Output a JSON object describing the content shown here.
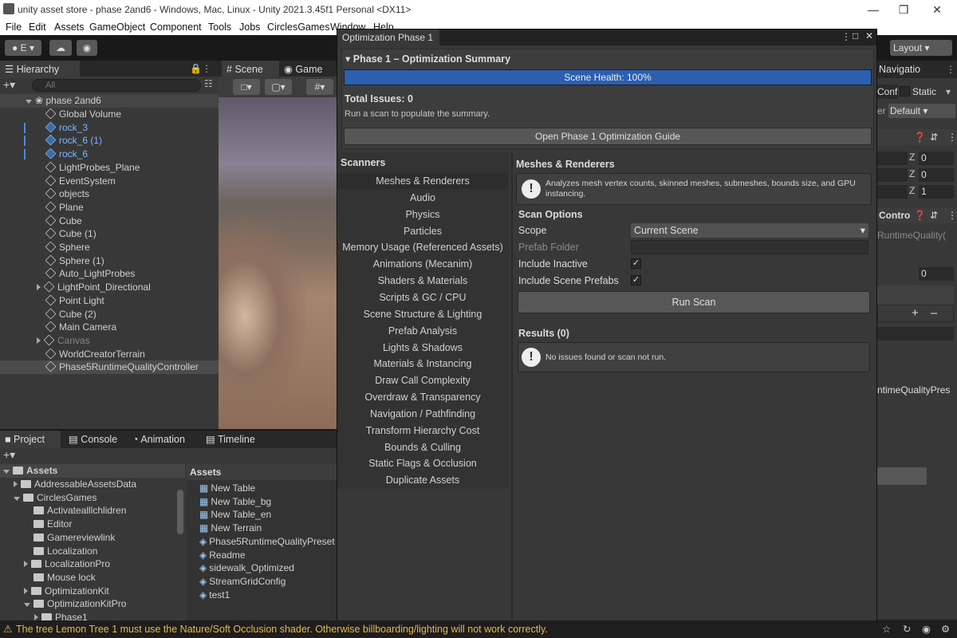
{
  "window": {
    "title": "unity asset store - phase 2and6 - Windows, Mac, Linux - Unity 2021.3.45f1 Personal <DX11>"
  },
  "menu": [
    "File",
    "Edit",
    "Assets",
    "GameObject",
    "Component",
    "Tools",
    "Jobs",
    "CirclesGames",
    "Window",
    "Help"
  ],
  "toolbar": {
    "account_label": "E",
    "layout_label": "Layout"
  },
  "hierarchy": {
    "tab": "Hierarchy",
    "search_placeholder": "All",
    "scene": "phase 2and6",
    "items": [
      "Global Volume",
      "rock_3",
      "rock_6 (1)",
      "rock_6",
      "LightProbes_Plane",
      "EventSystem",
      "objects",
      "Plane",
      "Cube",
      "Cube (1)",
      "Sphere",
      "Sphere (1)",
      "Auto_LightProbes",
      "LightPoint_Directional",
      "Point Light",
      "Cube (2)",
      "Main Camera",
      "Canvas",
      "WorldCreatorTerrain",
      "Phase5RuntimeQualityController"
    ]
  },
  "scene_tabs": {
    "scene": "Scene",
    "game": "Game"
  },
  "bottom_tabs": [
    "Project",
    "Console",
    "Animation",
    "Timeline"
  ],
  "project": {
    "root": "Assets",
    "tree": [
      "AddressableAssetsData",
      "CirclesGames",
      "Activatealllchlidren",
      "Editor",
      "Gamereviewlink",
      "Localization",
      "LocalizationPro",
      "Mouse lock",
      "OptimizationKit",
      "OptimizationKitPro",
      "Phase1"
    ],
    "assets_header": "Assets",
    "assets": [
      "New Table",
      "New Table_bg",
      "New Table_en",
      "New Terrain",
      "Phase5RuntimeQualityPreset",
      "Readme",
      "sidewalk_Optimized",
      "StreamGridConfig",
      "test1"
    ]
  },
  "opt": {
    "tab": "Optimization Phase 1",
    "summary_title": "Phase 1 – Optimization Summary",
    "health": "Scene Health: 100%",
    "health_value": 100,
    "total_issues": "Total Issues: 0",
    "hint": "Run a scan to populate the summary.",
    "guide_button": "Open Phase 1 Optimization Guide",
    "scanners_title": "Scanners",
    "scanners": [
      "Meshes & Renderers",
      "Audio",
      "Physics",
      "Particles",
      "Memory Usage (Referenced Assets)",
      "Animations (Mecanim)",
      "Shaders & Materials",
      "Scripts & GC / CPU",
      "Scene Structure & Lighting",
      "Prefab Analysis",
      "Lights & Shadows",
      "Materials & Instancing",
      "Draw Call Complexity",
      "Overdraw & Transparency",
      "Navigation / Pathfinding",
      "Transform Hierarchy Cost",
      "Bounds & Culling",
      "Static Flags & Occlusion",
      "Duplicate Assets"
    ],
    "detail_title": "Meshes & Renderers",
    "detail_info": "Analyzes mesh vertex counts, skinned meshes, submeshes, bounds size, and GPU instancing.",
    "scan_options": "Scan Options",
    "scope_label": "Scope",
    "scope_value": "Current Scene",
    "prefab_label": "Prefab Folder",
    "inactive_label": "Include Inactive",
    "prefabs_label": "Include Scene Prefabs",
    "run_button": "Run Scan",
    "results": "Results (0)",
    "no_issues": "No issues found or scan not run."
  },
  "inspector": {
    "navigation": "Navigatio",
    "conf": "Conf",
    "static": "Static",
    "default": "Default",
    "z0": "0",
    "z1": "0",
    "z2": "1",
    "contro": "Contro",
    "runtime1": "RuntimeQuality(",
    "zero": "0",
    "runtime2": "ntimeQualityPres"
  },
  "status": {
    "message": "The tree Lemon Tree 1 must use the Nature/Soft Occlusion shader. Otherwise billboarding/lighting will not work correctly."
  },
  "colors": {
    "accent": "#2b5fb0",
    "warning": "#e8b84a",
    "selected_text": "#7cb7ff"
  }
}
